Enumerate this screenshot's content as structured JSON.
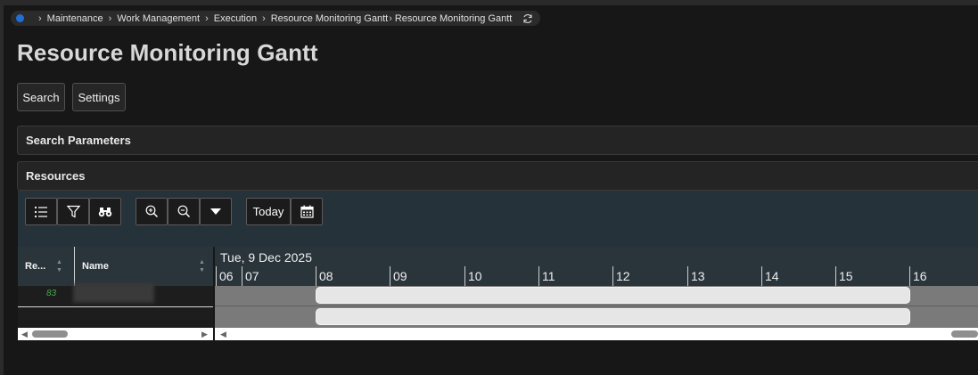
{
  "breadcrumb": [
    "Maintenance",
    "Work Management",
    "Execution",
    "Resource Monitoring Gantt",
    "Resource Monitoring Gantt"
  ],
  "page": {
    "title": "Resource Monitoring Gantt"
  },
  "actions": {
    "search": "Search",
    "settings": "Settings"
  },
  "panels": {
    "search_params": "Search Parameters",
    "resources": "Resources"
  },
  "toolbar": {
    "today": "Today"
  },
  "grid": {
    "columns": [
      "Re...",
      "Name"
    ],
    "rows": [
      {
        "status": "83",
        "name": ""
      },
      {
        "status": "",
        "name": ""
      }
    ]
  },
  "gantt": {
    "date": "Tue, 9 Dec 2025",
    "hours": [
      "06",
      "07",
      "08",
      "09",
      "10",
      "11",
      "12",
      "13",
      "14",
      "15",
      "16"
    ]
  }
}
